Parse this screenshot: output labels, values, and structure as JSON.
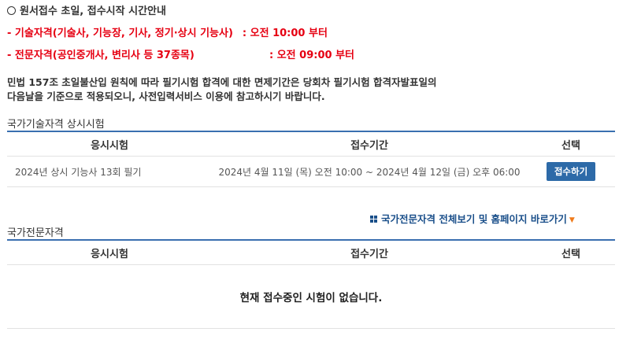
{
  "notice": {
    "heading": "원서접수 초일, 접수시작 시간안내",
    "lines": [
      {
        "label": "- 기술자격(기술사, 기능장, 기사, 정기·상시 기능사)",
        "time": ": 오전 10:00 부터"
      },
      {
        "label": "- 전문자격(공인중개사, 변리사 등 37종목)",
        "time": ": 오전 09:00 부터"
      }
    ],
    "paragraph_1": "민법 157조 초일불산입 원칙에 따라 필기시험 합격에 대한 면제기간은 당회차 필기시험 합격자발표일의",
    "paragraph_2": "다음날을 기준으로 적용되오니, 사전입력서비스 이용에 참고하시기 바랍니다."
  },
  "tech_section": {
    "title": "국가기술자격 상시시험",
    "headers": {
      "exam": "응시시험",
      "period": "접수기간",
      "select": "선택"
    },
    "rows": [
      {
        "exam": "2024년 상시 기능사 13회 필기",
        "period": "2024년 4월 11일 (목) 오전 10:00 ~ 2024년 4월 12일 (금) 오후 06:00",
        "button": "접수하기"
      }
    ]
  },
  "pro_section": {
    "title": "국가전문자격",
    "link_label": "국가전문자격 전체보기 및 홈페이지 바로가기",
    "headers": {
      "exam": "응시시험",
      "period": "접수기간",
      "select": "선택"
    },
    "empty_message": "현재 접수중인 시험이 없습니다."
  },
  "colors": {
    "alert_red": "#e60012",
    "table_border": "#3a6fb0",
    "button_blue": "#2d6aa8",
    "arrow_orange": "#f07a1a"
  }
}
